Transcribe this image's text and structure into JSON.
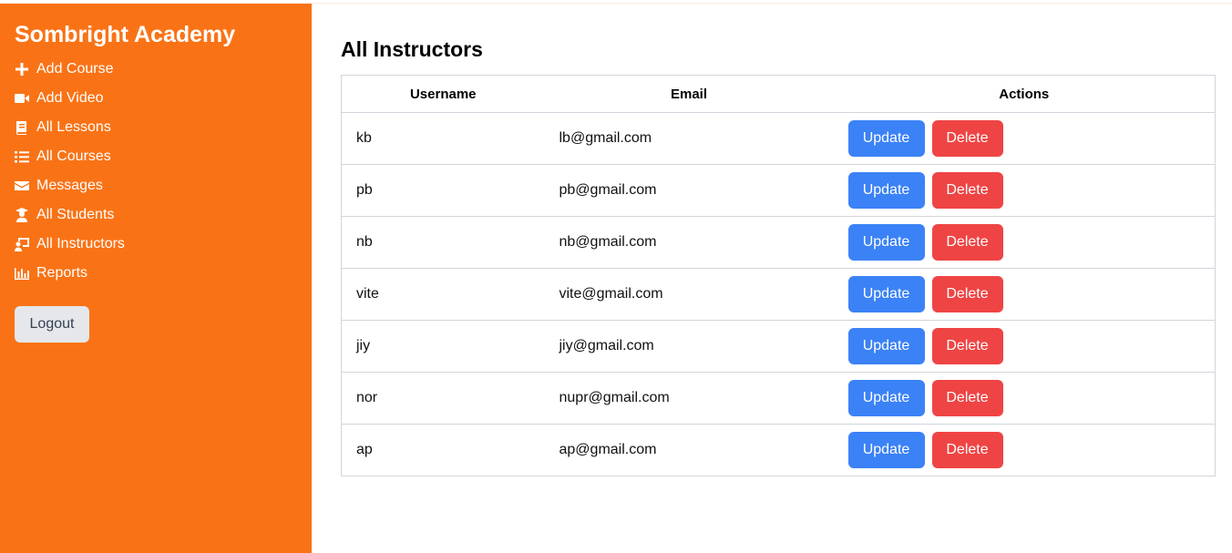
{
  "sidebar": {
    "brand": "Sombright Academy",
    "items": [
      {
        "label": "Add Course",
        "icon": "plus-icon"
      },
      {
        "label": "Add Video",
        "icon": "video-icon"
      },
      {
        "label": "All Lessons",
        "icon": "book-icon"
      },
      {
        "label": "All Courses",
        "icon": "list-icon"
      },
      {
        "label": "Messages",
        "icon": "envelope-icon"
      },
      {
        "label": "All Students",
        "icon": "student-icon"
      },
      {
        "label": "All Instructors",
        "icon": "instructor-icon"
      },
      {
        "label": "Reports",
        "icon": "chart-icon"
      }
    ],
    "logout_label": "Logout"
  },
  "main": {
    "title": "All Instructors",
    "table": {
      "headers": [
        "Username",
        "Email",
        "Actions"
      ],
      "rows": [
        {
          "username": "kb",
          "email": "lb@gmail.com"
        },
        {
          "username": "pb",
          "email": "pb@gmail.com"
        },
        {
          "username": "nb",
          "email": "nb@gmail.com"
        },
        {
          "username": "vite",
          "email": "vite@gmail.com"
        },
        {
          "username": "jiy",
          "email": "jiy@gmail.com"
        },
        {
          "username": "nor",
          "email": "nupr@gmail.com"
        },
        {
          "username": "ap",
          "email": "ap@gmail.com"
        }
      ],
      "update_label": "Update",
      "delete_label": "Delete"
    }
  },
  "colors": {
    "sidebar": "#f97316",
    "update": "#3b82f6",
    "delete": "#ef4444",
    "logout": "#e5e7eb"
  }
}
